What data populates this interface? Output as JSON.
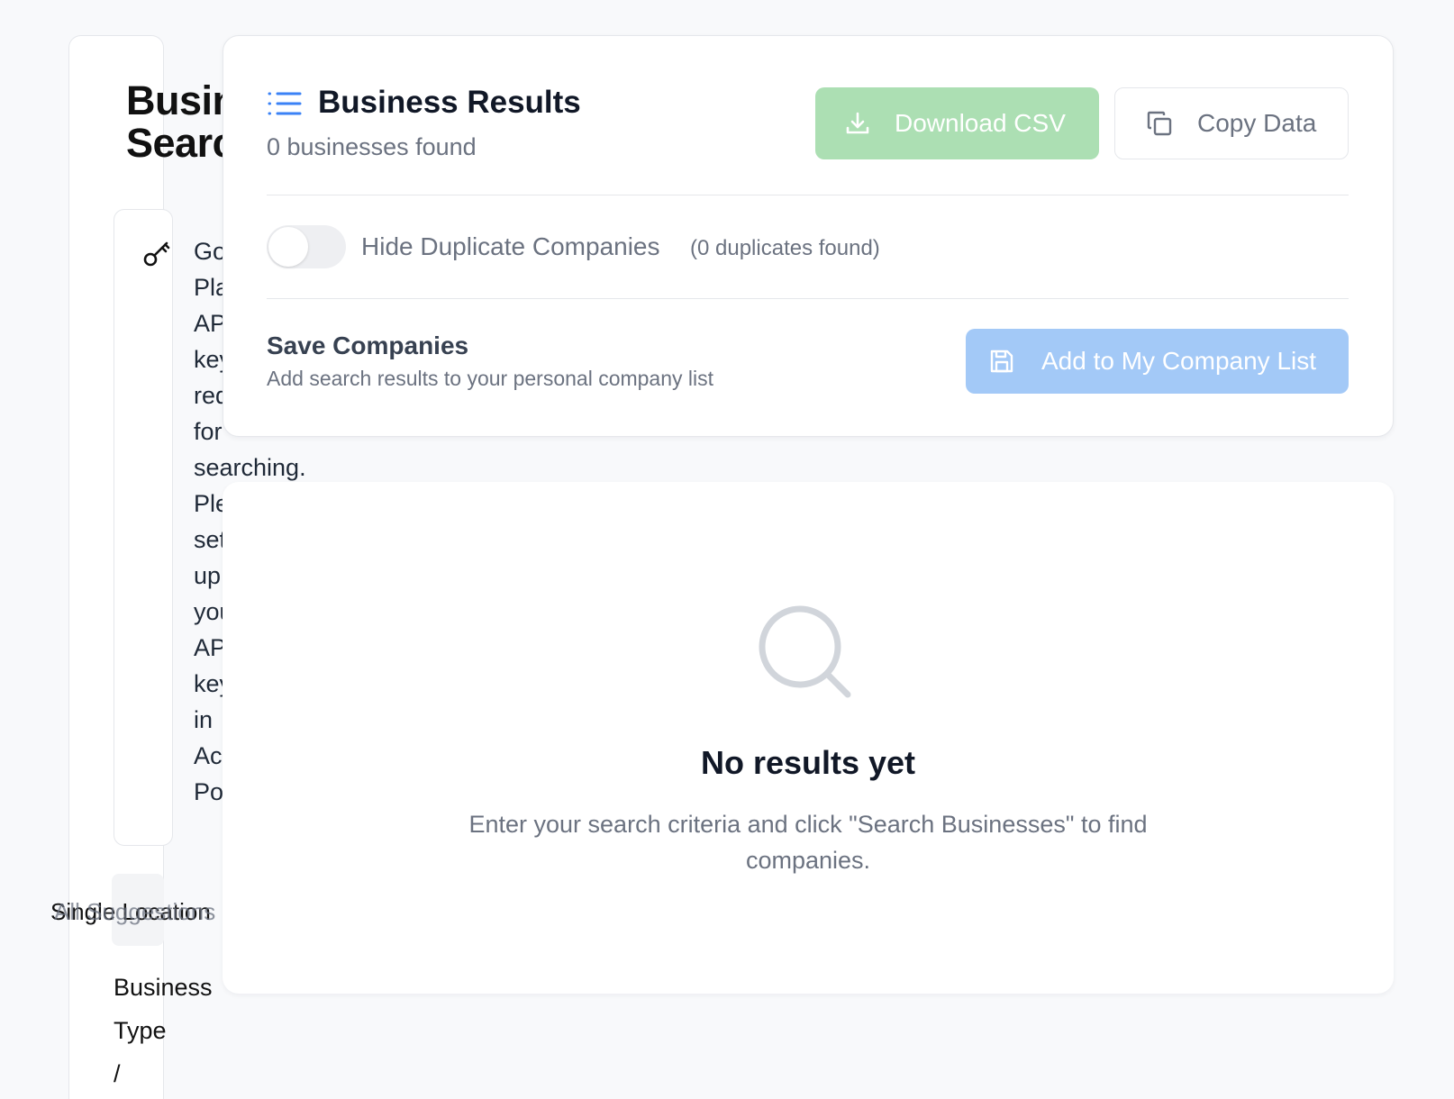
{
  "search_panel": {
    "title": "Business\nSearch",
    "api_notice_words": [
      "Google",
      "Places",
      "API",
      "key",
      "required",
      "for",
      "searching.",
      "Please",
      "set",
      "up",
      "your",
      "API",
      "keys",
      "in",
      "Account",
      "Portal."
    ],
    "mode_options": [
      "Single Location",
      "All Suggestions"
    ],
    "business_type_words": [
      "Business",
      "Type",
      "/"
    ]
  },
  "results": {
    "title": "Business Results",
    "count_text": "0 businesses found",
    "download_label": "Download CSV",
    "copy_label": "Copy Data",
    "hide_duplicates_label": "Hide Duplicate Companies",
    "duplicates_count": "(0 duplicates found)",
    "hide_duplicates_enabled": false,
    "save_title": "Save Companies",
    "save_description": "Add search results to your personal company list",
    "add_list_label": "Add to My Company List"
  },
  "empty_state": {
    "title": "No results yet",
    "description": "Enter your search criteria and click \"Search Businesses\" to find companies."
  },
  "colors": {
    "download_button": "#acdfb3",
    "add_button": "#a3c9f7",
    "accent_blue": "#3b82f6"
  },
  "icons": {
    "api_notice": "key-icon",
    "results_header": "list-icon",
    "download": "download-icon",
    "copy": "copy-icon",
    "save": "save-icon",
    "empty": "search-icon"
  }
}
